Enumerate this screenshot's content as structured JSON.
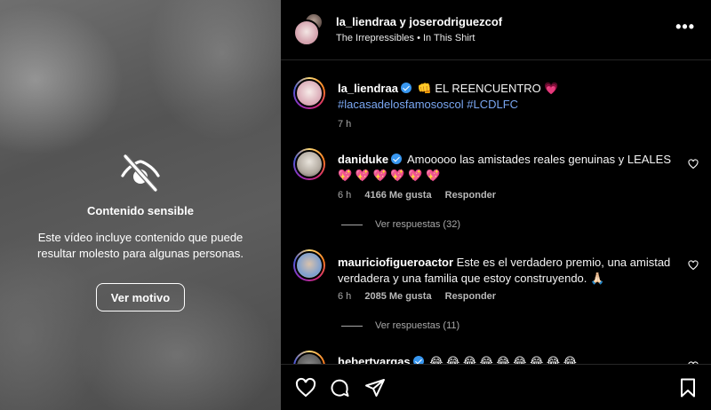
{
  "media": {
    "sensitive_title": "Contenido sensible",
    "sensitive_desc": "Este vídeo incluye contenido que puede resultar molesto para algunas personas.",
    "reason_button": "Ver motivo",
    "icon": "eye-slash-icon"
  },
  "header": {
    "users": "la_liendraa y joserodriguezcof",
    "audio": "The Irrepressibles • In This Shirt",
    "more_label": "•••"
  },
  "caption": {
    "username": "la_liendraa",
    "text": "👊 EL REENCUENTRO 💗",
    "hashtags": "#lacasadelosfamososcol #LCDLFC",
    "time": "7 h"
  },
  "comments": [
    {
      "username": "daniduke",
      "text": "Amooooo las amistades reales genuinas y LEALES",
      "text2": "💖 💖 💖 💖 💖 💖",
      "time": "6 h",
      "likes": "4166 Me gusta",
      "reply": "Responder",
      "view_replies": "Ver respuestas (32)"
    },
    {
      "username": "mauriciofigueroactor",
      "text": "Este es el verdadero premio, una amistad",
      "text2": "verdadera y una familia que estoy construyendo. 🙏🏻",
      "time": "6 h",
      "likes": "2085 Me gusta",
      "reply": "Responder",
      "view_replies": "Ver respuestas (11)"
    },
    {
      "username": "hebertvargas",
      "text": "😂 😂 😂 😂 😂 😂 😂 😂 😂"
    }
  ],
  "actions": [
    "heart-icon",
    "comment-icon",
    "share-icon",
    "bookmark-icon"
  ],
  "colors": {
    "hashtag": "#7aa7f2",
    "verified": "#3897f0",
    "background": "#000000"
  }
}
